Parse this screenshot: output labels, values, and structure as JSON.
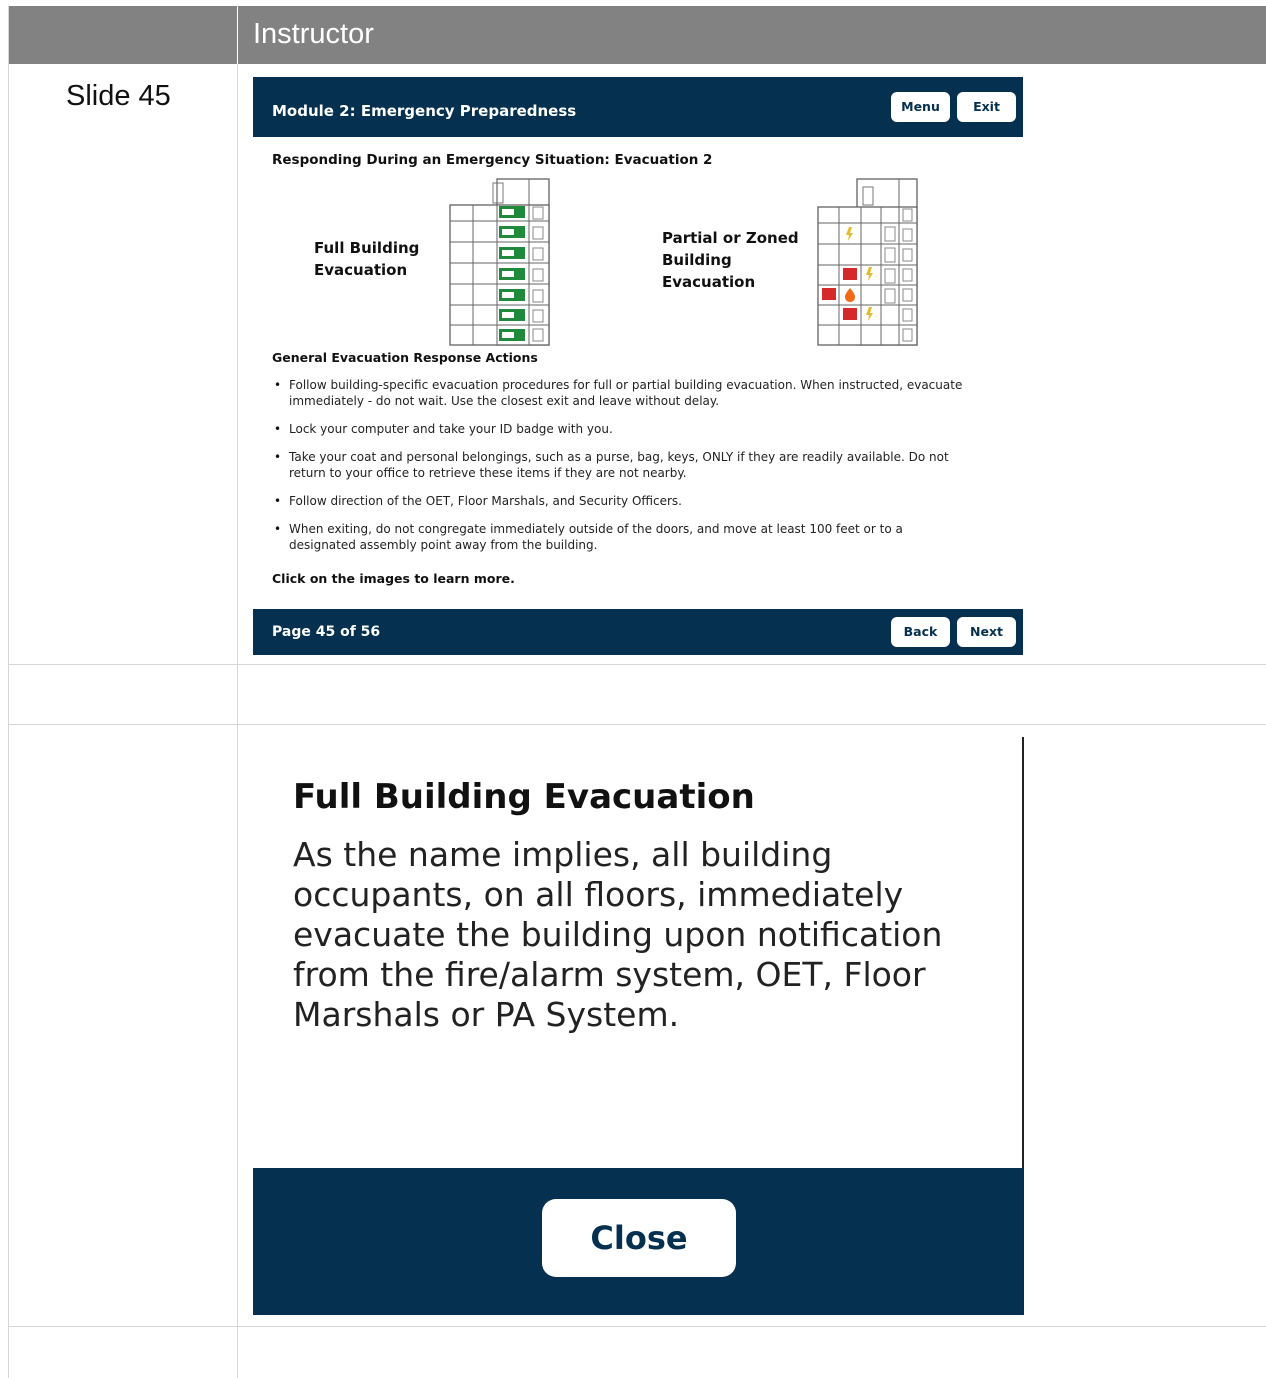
{
  "table": {
    "header_left": "",
    "header_right": "Instructor",
    "row1_label": "Slide 45"
  },
  "slide": {
    "module_title": "Module 2: Emergency Preparedness",
    "menu_label": "Menu",
    "exit_label": "Exit",
    "heading": "Responding During an Emergency Situation: Evacuation 2",
    "full_line1": "Full Building",
    "full_line2": "Evacuation",
    "partial_line1": "Partial or Zoned",
    "partial_line2": "Building",
    "partial_line3": "Evacuation",
    "section_title": "General Evacuation Response Actions",
    "bullets": [
      "Follow building-specific evacuation procedures for full or partial building evacuation. When instructed, evacuate immediately - do not wait. Use the closest exit and leave without delay.",
      "Lock your computer and take your ID badge with you.",
      "Take your coat and personal belongings, such as a purse, bag, keys, ONLY if they are readily available.  Do not return to your office to retrieve these items if they are not nearby.",
      "Follow direction of the OET, Floor Marshals, and Security Officers.",
      "When exiting, do not congregate immediately outside of the doors, and move at least 100 feet or to a designated assembly point away from the building."
    ],
    "click_note": "Click on the images to learn more.",
    "page_label": "Page 45 of 56",
    "back_label": "Back",
    "next_label": "Next"
  },
  "popup": {
    "title": "Full Building Evacuation",
    "body": "As the name implies, all building occupants, on all floors, immediately evacuate the building upon notification from the fire/alarm system, OET, Floor Marshals or PA System.",
    "close_label": "Close"
  },
  "colors": {
    "header_gray": "#828282",
    "navy": "#05304f",
    "exit_green": "#1f8a3c",
    "alarm_red": "#d42a2a"
  }
}
